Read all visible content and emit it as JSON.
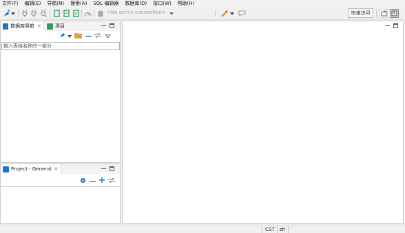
{
  "menu": [
    "文件(F)",
    "编辑(E)",
    "导航(N)",
    "搜索(A)",
    "SQL 编辑器",
    "数据库(D)",
    "窗口(W)",
    "帮助(H)"
  ],
  "toolbar": {
    "connection_label": "<No active connection>",
    "quick_access": "快速访问"
  },
  "nav_panel": {
    "tabs": [
      {
        "label": "数据库导航"
      },
      {
        "label": "项目"
      }
    ],
    "filter_placeholder": "输入表格名称的一部分"
  },
  "project_panel": {
    "tab_label": "Project - General"
  },
  "status": {
    "timezone": "CST",
    "locale": "zh"
  },
  "colors": {
    "accent_blue": "#1f73c8",
    "folder_orange": "#e0a23a",
    "green": "#2f9a5a",
    "window_bg": "#f0f0f0"
  }
}
